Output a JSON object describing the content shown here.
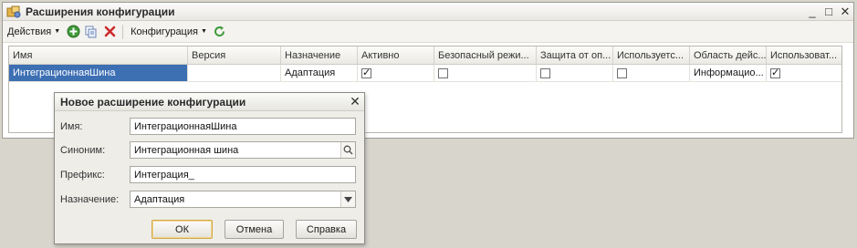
{
  "window": {
    "title": "Расширения конфигурации",
    "controls": [
      "_",
      "□",
      "✕"
    ]
  },
  "toolbar": {
    "actions_label": "Действия",
    "configuration_label": "Конфигурация",
    "icons": [
      "add-icon",
      "copy-icon",
      "delete-icon",
      "refresh-icon"
    ]
  },
  "table": {
    "columns": [
      "Имя",
      "Версия",
      "Назначение",
      "Активно",
      "Безопасный режи...",
      "Защита от оп...",
      "Используетс...",
      "Область дейс...",
      "Использоват..."
    ],
    "rows": [
      {
        "name": "ИнтеграционнаяШина",
        "version": "",
        "purpose": "Адаптация",
        "active": true,
        "safe_mode": false,
        "protection": false,
        "used": false,
        "scope": "Информацио...",
        "usage": true
      }
    ]
  },
  "dialog": {
    "title": "Новое расширение конфигурации",
    "fields": {
      "name_label": "Имя:",
      "name_value": "ИнтеграционнаяШина",
      "synonym_label": "Синоним:",
      "synonym_value": "Интеграционная шина",
      "prefix_label": "Префикс:",
      "prefix_value": "Интеграция_",
      "purpose_label": "Назначение:",
      "purpose_value": "Адаптация"
    },
    "buttons": {
      "ok": "ОК",
      "cancel": "Отмена",
      "help": "Справка"
    }
  },
  "colors": {
    "selection": "#3d6fb3",
    "add_green": "#3f9a3a",
    "delete_red": "#cc2a2a"
  }
}
